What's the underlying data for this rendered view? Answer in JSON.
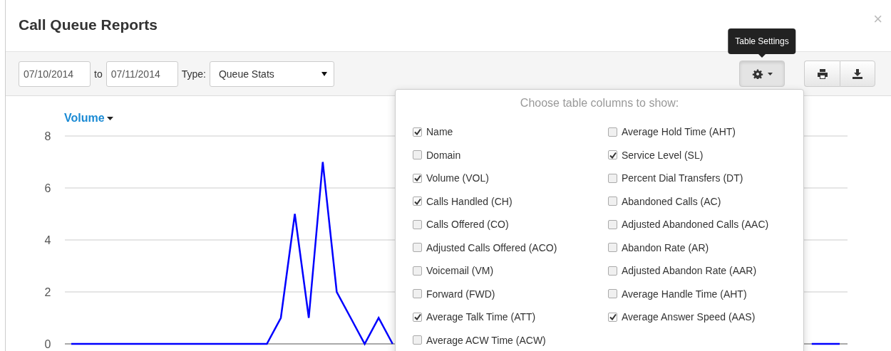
{
  "dialog": {
    "title": "Call Queue Reports",
    "close": "×"
  },
  "toolbar": {
    "from_date": "07/10/2014",
    "to_label": "to",
    "to_date": "07/11/2014",
    "type_label": "Type:",
    "type_value": "Queue Stats",
    "tooltip": "Table Settings"
  },
  "chart": {
    "chart_data": {
      "type": "line",
      "grid": true,
      "ylim": [
        0,
        8
      ],
      "yticks": [
        0,
        2,
        4,
        6,
        8
      ],
      "series": [
        {
          "name": "Volume",
          "color": "#0000ff",
          "values": [
            0,
            0,
            0,
            0,
            0,
            0,
            0,
            0,
            0,
            0,
            0,
            0,
            0,
            0,
            0,
            1,
            5,
            1,
            7,
            2,
            1,
            0,
            1,
            0,
            null,
            null,
            null,
            null,
            null,
            null,
            null,
            null,
            null,
            null,
            null,
            null,
            null,
            null,
            null,
            null,
            null,
            null,
            null,
            null,
            null,
            null,
            null,
            null,
            null,
            null,
            null,
            null,
            null,
            0,
            0,
            0
          ]
        }
      ]
    }
  },
  "column_chooser": {
    "heading": "Choose table columns to show:",
    "left_column": [
      {
        "label": "Name",
        "checked": true
      },
      {
        "label": "Domain",
        "checked": false
      },
      {
        "label": "Volume (VOL)",
        "checked": true
      },
      {
        "label": "Calls Handled (CH)",
        "checked": true
      },
      {
        "label": "Calls Offered (CO)",
        "checked": false
      },
      {
        "label": "Adjusted Calls Offered (ACO)",
        "checked": false
      },
      {
        "label": "Voicemail (VM)",
        "checked": false
      },
      {
        "label": "Forward (FWD)",
        "checked": false
      },
      {
        "label": "Average Talk Time (ATT)",
        "checked": true
      },
      {
        "label": "Average ACW Time (ACW)",
        "checked": false
      }
    ],
    "right_column": [
      {
        "label": "Average Hold Time (AHT)",
        "checked": false
      },
      {
        "label": "Service Level (SL)",
        "checked": true
      },
      {
        "label": "Percent Dial Transfers (DT)",
        "checked": false
      },
      {
        "label": "Abandoned Calls (AC)",
        "checked": false
      },
      {
        "label": "Adjusted Abandoned Calls (AAC)",
        "checked": false
      },
      {
        "label": "Abandon Rate (AR)",
        "checked": false
      },
      {
        "label": "Adjusted Abandon Rate (AAR)",
        "checked": false
      },
      {
        "label": "Average Handle Time (AHT)",
        "checked": false
      },
      {
        "label": "Average Answer Speed (AAS)",
        "checked": true
      }
    ]
  }
}
